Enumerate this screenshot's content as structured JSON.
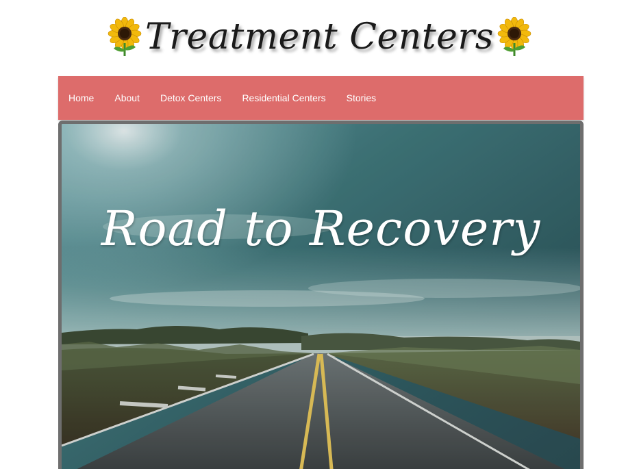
{
  "logo": {
    "text": "Treatment Centers",
    "icon_left": "sunflower-icon",
    "icon_right": "sunflower-icon"
  },
  "nav": {
    "background": "#dd6c6b",
    "items": [
      {
        "label": "Home"
      },
      {
        "label": "About"
      },
      {
        "label": "Detox Centers"
      },
      {
        "label": "Residential Centers"
      },
      {
        "label": "Stories"
      }
    ]
  },
  "hero": {
    "title": "Road to Recovery",
    "image": "road-landscape-photo"
  }
}
